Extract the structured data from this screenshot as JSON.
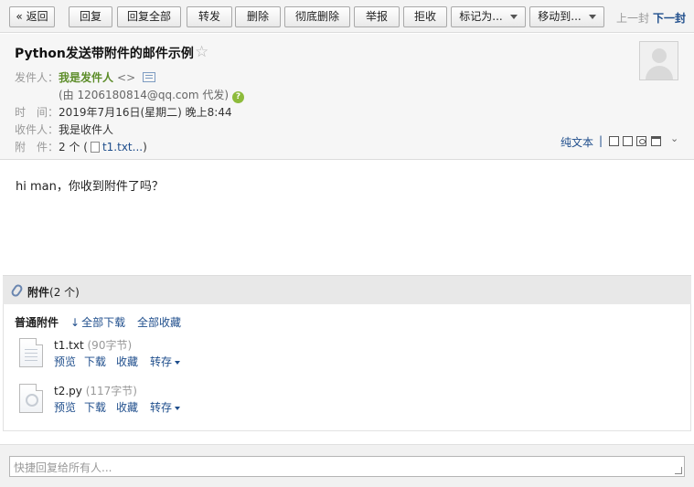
{
  "toolbar": {
    "back": "« 返回",
    "reply": "回复",
    "reply_all": "回复全部",
    "forward": "转发",
    "delete": "删除",
    "delete_permanent": "彻底删除",
    "report": "举报",
    "reject": "拒收",
    "mark_as": "标记为...",
    "move_to": "移动到...",
    "prev": "上一封",
    "next": "下一封"
  },
  "mail": {
    "subject": "Python发送带附件的邮件示例",
    "star_icon": "☆",
    "from_label": "发件人：",
    "from_name": "我是发件人",
    "from_addr": "<>",
    "proxy": "(由 1206180814@qq.com 代发)",
    "time_label": "时　间：",
    "time_value": "2019年7月16日(星期二) 晚上8:44",
    "to_label": "收件人：",
    "to_value": "我是收件人",
    "attach_label": "附　件：",
    "attach_count": "2 个 (",
    "attach_name": "t1.txt...",
    "attach_close": ")",
    "plain_text": "纯文本",
    "separator": "|",
    "body": "hi man，你收到附件了吗？"
  },
  "attachments": {
    "title_bold": "附件",
    "title_count": "(2 个)",
    "type_label": "普通附件",
    "download_all": "全部下载",
    "favorite_all": "全部收藏",
    "files": [
      {
        "name": "t1.txt",
        "size": "(90字节)",
        "preview": "预览",
        "download": "下载",
        "favorite": "收藏",
        "transfer": "转存"
      },
      {
        "name": "t2.py",
        "size": "(117字节)",
        "preview": "预览",
        "download": "下载",
        "favorite": "收藏",
        "transfer": "转存"
      }
    ]
  },
  "reply": {
    "placeholder": "快捷回复给所有人..."
  }
}
